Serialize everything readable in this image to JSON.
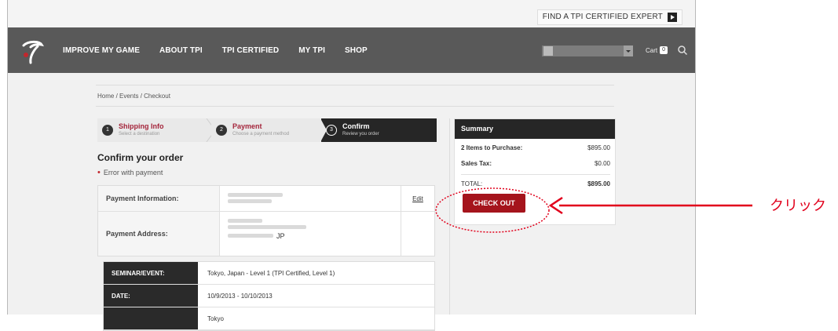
{
  "topbar": {
    "find_expert_label": "FIND A TPI CERTIFIED EXPERT"
  },
  "nav": {
    "items": [
      "IMPROVE MY GAME",
      "ABOUT TPI",
      "TPI CERTIFIED",
      "MY TPI",
      "SHOP"
    ],
    "cart_label": "Cart",
    "cart_count": "0"
  },
  "breadcrumb": {
    "text": "Home  /  Events  /  Checkout"
  },
  "steps": [
    {
      "num": "1",
      "title": "Shipping Info",
      "subtitle": "Select a destination"
    },
    {
      "num": "2",
      "title": "Payment",
      "subtitle": "Choose a payment method"
    },
    {
      "num": "3",
      "title": "Confirm",
      "subtitle": "Review you order"
    }
  ],
  "order": {
    "title": "Confirm your order",
    "error": "Error with payment",
    "payment_info_label": "Payment Information:",
    "edit_label": "Edit",
    "payment_address_label": "Payment Address:",
    "country": "JP"
  },
  "event": {
    "rows": [
      {
        "label": "SEMINAR/EVENT:",
        "value": "Tokyo, Japan - Level 1 (TPI Certified, Level 1)"
      },
      {
        "label": "DATE:",
        "value": "10/9/2013 - 10/10/2013"
      },
      {
        "label": "",
        "value": "Tokyo"
      }
    ]
  },
  "summary": {
    "title": "Summary",
    "items_label": "2 Items to Purchase:",
    "items_value": "$895.00",
    "tax_label": "Sales Tax:",
    "tax_value": "$0.00",
    "total_label": "TOTAL:",
    "total_value": "$895.00",
    "checkout_label": "CHECK OUT"
  },
  "annotation": {
    "label": "クリック",
    "color": "#e1001b"
  },
  "colors": {
    "accent": "#a5141c",
    "nav_bg": "#595959",
    "dark": "#262626"
  }
}
